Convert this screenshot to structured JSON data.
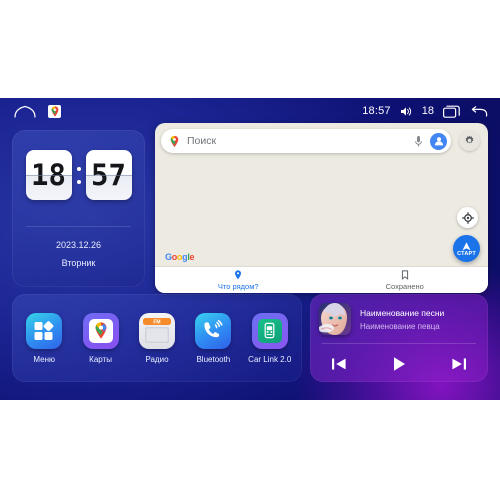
{
  "statusbar": {
    "home_icon": "home-icon",
    "maps_icon": "google-maps-icon",
    "time": "18:57",
    "volume_icon": "volume-icon",
    "volume_level": "18",
    "recents_icon": "recent-apps-icon",
    "back_icon": "back-arrow-icon"
  },
  "clock": {
    "hours": "18",
    "minutes": "57",
    "date": "2023.12.26",
    "weekday": "Вторник"
  },
  "maps": {
    "search_placeholder": "Поиск",
    "search_value": "",
    "pin_icon": "map-pin-icon",
    "mic_icon": "microphone-icon",
    "avatar_icon": "account-avatar-icon",
    "settings_icon": "gear-icon",
    "locate_icon": "my-location-icon",
    "start_label": "СТАРТ",
    "watermark": "Google",
    "tabs": [
      {
        "label": "Что рядом?",
        "icon": "map-pin-icon",
        "active": true
      },
      {
        "label": "Сохранено",
        "icon": "bookmark-icon",
        "active": false
      }
    ]
  },
  "apps": [
    {
      "label": "Меню",
      "icon": "apps-grid-icon"
    },
    {
      "label": "Карты",
      "icon": "google-maps-icon"
    },
    {
      "label": "Радио",
      "icon": "radio-icon"
    },
    {
      "label": "Bluetooth",
      "icon": "bluetooth-phone-icon"
    },
    {
      "label": "Car Link 2.0",
      "icon": "car-link-icon"
    }
  ],
  "music": {
    "title": "Наименование песни",
    "artist": "Наименование певца",
    "album_art": "album-art-portrait",
    "prev_icon": "previous-track-icon",
    "play_icon": "play-icon",
    "next_icon": "next-track-icon"
  },
  "colors": {
    "accent_blue": "#1a73e8",
    "bg_blue": "#17209a",
    "bg_purple": "#5b10a8",
    "maps_bg": "#eceae1"
  }
}
